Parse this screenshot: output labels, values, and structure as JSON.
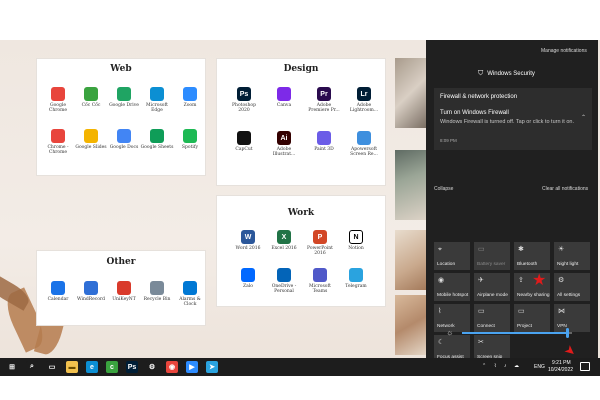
{
  "desktop": {
    "groups": [
      {
        "title": "Web",
        "apps": [
          {
            "label": "Google Chrome",
            "icon": "chrome-icon",
            "color": "#e8453c"
          },
          {
            "label": "Cốc Cốc",
            "icon": "coccoc-icon",
            "color": "#3aa33f"
          },
          {
            "label": "Google Drive",
            "icon": "google-drive-icon",
            "color": "#1fa463"
          },
          {
            "label": "Microsoft Edge",
            "icon": "edge-icon",
            "color": "#0c8fd3"
          },
          {
            "label": "Zoom",
            "icon": "zoom-icon",
            "color": "#2d8cff"
          },
          {
            "label": "Chrome - Chrome",
            "icon": "chrome-icon",
            "color": "#e8453c"
          },
          {
            "label": "Google Slides",
            "icon": "google-slides-icon",
            "color": "#f4b400"
          },
          {
            "label": "Google Docs",
            "icon": "google-docs-icon",
            "color": "#4285f4"
          },
          {
            "label": "Google Sheets",
            "icon": "google-sheets-icon",
            "color": "#0f9d58"
          },
          {
            "label": "Spotify",
            "icon": "spotify-icon",
            "color": "#1db954"
          }
        ]
      },
      {
        "title": "Design",
        "apps": [
          {
            "label": "Photoshop 2020",
            "icon": "photoshop-icon",
            "color": "#001e36",
            "glyph": "Ps"
          },
          {
            "label": "Canva",
            "icon": "canva-icon",
            "color": "#7d2ae8"
          },
          {
            "label": "Adobe Premiere Pr...",
            "icon": "premiere-icon",
            "color": "#2a0b4e",
            "glyph": "Pr"
          },
          {
            "label": "Adobe Lightroom...",
            "icon": "lightroom-icon",
            "color": "#001e36",
            "glyph": "Lr"
          },
          {
            "label": "CapCut",
            "icon": "capcut-icon",
            "color": "#111111"
          },
          {
            "label": "Adobe Illustrat...",
            "icon": "illustrator-icon",
            "color": "#330000",
            "glyph": "Ai"
          },
          {
            "label": "Paint 3D",
            "icon": "paint3d-icon",
            "color": "#6b5ce7"
          },
          {
            "label": "Apowersoft Screen Re...",
            "icon": "apowersoft-icon",
            "color": "#3e8fde"
          }
        ]
      },
      {
        "title": "Work",
        "apps": [
          {
            "label": "Word 2016",
            "icon": "word-icon",
            "color": "#2b579a",
            "glyph": "W"
          },
          {
            "label": "Excel 2016",
            "icon": "excel-icon",
            "color": "#217346",
            "glyph": "X"
          },
          {
            "label": "PowerPoint 2016",
            "icon": "powerpoint-icon",
            "color": "#d24726",
            "glyph": "P"
          },
          {
            "label": "Notion",
            "icon": "notion-icon",
            "color": "#ffffff",
            "glyph": "N"
          },
          {
            "label": "Zalo",
            "icon": "zalo-icon",
            "color": "#0068ff"
          },
          {
            "label": "OneDrive - Personal",
            "icon": "onedrive-icon",
            "color": "#0364b8"
          },
          {
            "label": "Microsoft Teams",
            "icon": "teams-icon",
            "color": "#5059c9"
          },
          {
            "label": "Telegram",
            "icon": "telegram-icon",
            "color": "#2aa3df"
          }
        ]
      },
      {
        "title": "Other",
        "apps": [
          {
            "label": "Calendar",
            "icon": "calendar-icon",
            "color": "#1a73e8"
          },
          {
            "label": "WindRecord",
            "icon": "windrecord-icon",
            "color": "#2f6fd6"
          },
          {
            "label": "UniKeyNT",
            "icon": "unikey-icon",
            "color": "#d93a2b"
          },
          {
            "label": "Recycle Bin",
            "icon": "recycle-bin-icon",
            "color": "#7a8a99"
          },
          {
            "label": "Alarms & Clock",
            "icon": "alarms-clock-icon",
            "color": "#0078d4"
          }
        ]
      }
    ]
  },
  "action_center": {
    "manage_notifications": "Manage notifications",
    "app_name": "Windows Security",
    "notification_title": "Firewall & network protection",
    "notification_heading": "Turn on Windows Firewall",
    "notification_body": "Windows Firewall is turned off. Tap or click to turn it on.",
    "notification_time": "8:09 PM",
    "collapse": "Collapse",
    "clear_all": "Clear all notifications",
    "tiles": [
      {
        "label": "Location",
        "icon": "location-icon",
        "glyph": "⌖",
        "state": "on"
      },
      {
        "label": "Battery saver",
        "icon": "battery-saver-icon",
        "glyph": "▭",
        "state": "dim"
      },
      {
        "label": "Bluetooth",
        "icon": "bluetooth-icon",
        "glyph": "✱",
        "state": "on"
      },
      {
        "label": "Night light",
        "icon": "night-light-icon",
        "glyph": "☀",
        "state": "on"
      },
      {
        "label": "Mobile hotspot",
        "icon": "mobile-hotspot-icon",
        "glyph": "◉",
        "state": "on"
      },
      {
        "label": "Airplane mode",
        "icon": "airplane-icon",
        "glyph": "✈",
        "state": "on"
      },
      {
        "label": "Nearby sharing",
        "icon": "nearby-sharing-icon",
        "glyph": "⇪",
        "state": "on"
      },
      {
        "label": "All settings",
        "icon": "settings-icon",
        "glyph": "⚙",
        "state": "on"
      },
      {
        "label": "Network",
        "icon": "network-icon",
        "glyph": "⌇",
        "state": "on"
      },
      {
        "label": "Connect",
        "icon": "connect-icon",
        "glyph": "▭",
        "state": "on"
      },
      {
        "label": "Project",
        "icon": "project-icon",
        "glyph": "▭",
        "state": "on"
      },
      {
        "label": "VPN",
        "icon": "vpn-icon",
        "glyph": "⋈",
        "state": "on"
      },
      {
        "label": "Focus assist",
        "icon": "focus-assist-icon",
        "glyph": "☾",
        "state": "on"
      },
      {
        "label": "Screen snip",
        "icon": "screen-snip-icon",
        "glyph": "✂",
        "state": "on"
      }
    ],
    "brightness": 0.95,
    "accent": "#4aa3f0"
  },
  "taskbar": {
    "pinned": [
      {
        "name": "start-icon",
        "color": "#1d1d1d"
      },
      {
        "name": "search-icon",
        "color": "#1d1d1d"
      },
      {
        "name": "task-view-icon",
        "color": "#1d1d1d"
      },
      {
        "name": "file-explorer-icon",
        "color": "#f2c14e"
      },
      {
        "name": "edge-icon",
        "color": "#0c8fd3"
      },
      {
        "name": "coccoc-icon",
        "color": "#3aa33f"
      },
      {
        "name": "photoshop-icon",
        "color": "#001e36",
        "glyph": "Ps"
      },
      {
        "name": "settings-icon",
        "color": "#1d1d1d"
      },
      {
        "name": "chrome-icon",
        "color": "#e8453c"
      },
      {
        "name": "zoom-icon",
        "color": "#2d8cff"
      },
      {
        "name": "telegram-icon",
        "color": "#2aa3df"
      }
    ],
    "language": "ENG",
    "time": "9:21 PM",
    "date": "10/24/2022"
  }
}
